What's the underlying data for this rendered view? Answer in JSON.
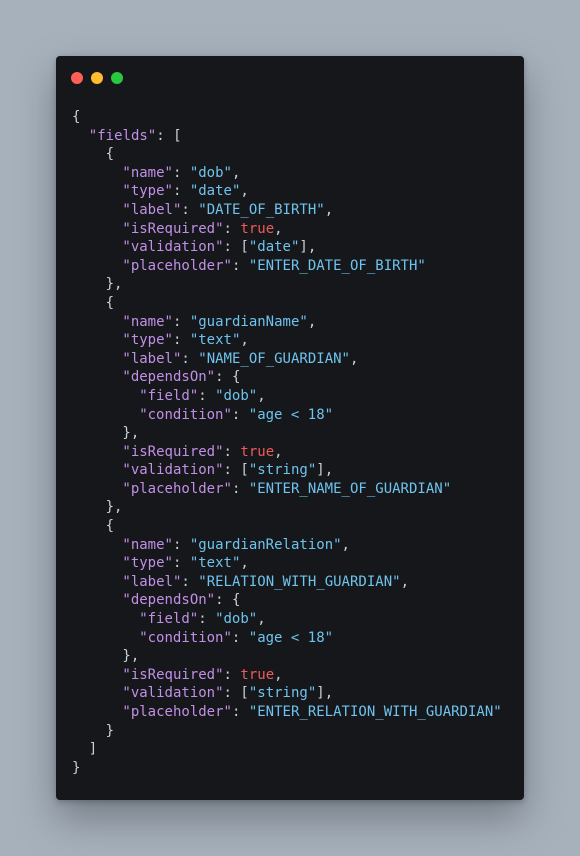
{
  "window": {
    "controls": [
      {
        "name": "close",
        "color": "#ff5f57"
      },
      {
        "name": "minimize",
        "color": "#febc2e"
      },
      {
        "name": "maximize",
        "color": "#28c840"
      }
    ]
  },
  "code": {
    "colors": {
      "key": "#c190e6",
      "string": "#6fc3ee",
      "boolean": "#ef5b5b",
      "punctuation": "#c9d1d9",
      "background": "#15171a",
      "page_background": "#a7b1bc"
    },
    "lines": [
      {
        "indent": 0,
        "tokens": [
          {
            "t": "p",
            "v": "{"
          }
        ]
      },
      {
        "indent": 1,
        "tokens": [
          {
            "t": "k",
            "v": "\"fields\""
          },
          {
            "t": "p",
            "v": ": ["
          }
        ]
      },
      {
        "indent": 2,
        "tokens": [
          {
            "t": "p",
            "v": "{"
          }
        ]
      },
      {
        "indent": 3,
        "tokens": [
          {
            "t": "k",
            "v": "\"name\""
          },
          {
            "t": "p",
            "v": ": "
          },
          {
            "t": "s",
            "v": "\"dob\""
          },
          {
            "t": "p",
            "v": ","
          }
        ]
      },
      {
        "indent": 3,
        "tokens": [
          {
            "t": "k",
            "v": "\"type\""
          },
          {
            "t": "p",
            "v": ": "
          },
          {
            "t": "s",
            "v": "\"date\""
          },
          {
            "t": "p",
            "v": ","
          }
        ]
      },
      {
        "indent": 3,
        "tokens": [
          {
            "t": "k",
            "v": "\"label\""
          },
          {
            "t": "p",
            "v": ": "
          },
          {
            "t": "s",
            "v": "\"DATE_OF_BIRTH\""
          },
          {
            "t": "p",
            "v": ","
          }
        ]
      },
      {
        "indent": 3,
        "tokens": [
          {
            "t": "k",
            "v": "\"isRequired\""
          },
          {
            "t": "p",
            "v": ": "
          },
          {
            "t": "b",
            "v": "true"
          },
          {
            "t": "p",
            "v": ","
          }
        ]
      },
      {
        "indent": 3,
        "tokens": [
          {
            "t": "k",
            "v": "\"validation\""
          },
          {
            "t": "p",
            "v": ": ["
          },
          {
            "t": "s",
            "v": "\"date\""
          },
          {
            "t": "p",
            "v": "],"
          }
        ]
      },
      {
        "indent": 3,
        "tokens": [
          {
            "t": "k",
            "v": "\"placeholder\""
          },
          {
            "t": "p",
            "v": ": "
          },
          {
            "t": "s",
            "v": "\"ENTER_DATE_OF_BIRTH\""
          }
        ]
      },
      {
        "indent": 2,
        "tokens": [
          {
            "t": "p",
            "v": "},"
          }
        ]
      },
      {
        "indent": 2,
        "tokens": [
          {
            "t": "p",
            "v": "{"
          }
        ]
      },
      {
        "indent": 3,
        "tokens": [
          {
            "t": "k",
            "v": "\"name\""
          },
          {
            "t": "p",
            "v": ": "
          },
          {
            "t": "s",
            "v": "\"guardianName\""
          },
          {
            "t": "p",
            "v": ","
          }
        ]
      },
      {
        "indent": 3,
        "tokens": [
          {
            "t": "k",
            "v": "\"type\""
          },
          {
            "t": "p",
            "v": ": "
          },
          {
            "t": "s",
            "v": "\"text\""
          },
          {
            "t": "p",
            "v": ","
          }
        ]
      },
      {
        "indent": 3,
        "tokens": [
          {
            "t": "k",
            "v": "\"label\""
          },
          {
            "t": "p",
            "v": ": "
          },
          {
            "t": "s",
            "v": "\"NAME_OF_GUARDIAN\""
          },
          {
            "t": "p",
            "v": ","
          }
        ]
      },
      {
        "indent": 3,
        "tokens": [
          {
            "t": "k",
            "v": "\"dependsOn\""
          },
          {
            "t": "p",
            "v": ": {"
          }
        ]
      },
      {
        "indent": 4,
        "tokens": [
          {
            "t": "k",
            "v": "\"field\""
          },
          {
            "t": "p",
            "v": ": "
          },
          {
            "t": "s",
            "v": "\"dob\""
          },
          {
            "t": "p",
            "v": ","
          }
        ]
      },
      {
        "indent": 4,
        "tokens": [
          {
            "t": "k",
            "v": "\"condition\""
          },
          {
            "t": "p",
            "v": ": "
          },
          {
            "t": "s",
            "v": "\"age < 18\""
          }
        ]
      },
      {
        "indent": 3,
        "tokens": [
          {
            "t": "p",
            "v": "},"
          }
        ]
      },
      {
        "indent": 3,
        "tokens": [
          {
            "t": "k",
            "v": "\"isRequired\""
          },
          {
            "t": "p",
            "v": ": "
          },
          {
            "t": "b",
            "v": "true"
          },
          {
            "t": "p",
            "v": ","
          }
        ]
      },
      {
        "indent": 3,
        "tokens": [
          {
            "t": "k",
            "v": "\"validation\""
          },
          {
            "t": "p",
            "v": ": ["
          },
          {
            "t": "s",
            "v": "\"string\""
          },
          {
            "t": "p",
            "v": "],"
          }
        ]
      },
      {
        "indent": 3,
        "tokens": [
          {
            "t": "k",
            "v": "\"placeholder\""
          },
          {
            "t": "p",
            "v": ": "
          },
          {
            "t": "s",
            "v": "\"ENTER_NAME_OF_GUARDIAN\""
          }
        ]
      },
      {
        "indent": 2,
        "tokens": [
          {
            "t": "p",
            "v": "},"
          }
        ]
      },
      {
        "indent": 2,
        "tokens": [
          {
            "t": "p",
            "v": "{"
          }
        ]
      },
      {
        "indent": 3,
        "tokens": [
          {
            "t": "k",
            "v": "\"name\""
          },
          {
            "t": "p",
            "v": ": "
          },
          {
            "t": "s",
            "v": "\"guardianRelation\""
          },
          {
            "t": "p",
            "v": ","
          }
        ]
      },
      {
        "indent": 3,
        "tokens": [
          {
            "t": "k",
            "v": "\"type\""
          },
          {
            "t": "p",
            "v": ": "
          },
          {
            "t": "s",
            "v": "\"text\""
          },
          {
            "t": "p",
            "v": ","
          }
        ]
      },
      {
        "indent": 3,
        "tokens": [
          {
            "t": "k",
            "v": "\"label\""
          },
          {
            "t": "p",
            "v": ": "
          },
          {
            "t": "s",
            "v": "\"RELATION_WITH_GUARDIAN\""
          },
          {
            "t": "p",
            "v": ","
          }
        ]
      },
      {
        "indent": 3,
        "tokens": [
          {
            "t": "k",
            "v": "\"dependsOn\""
          },
          {
            "t": "p",
            "v": ": {"
          }
        ]
      },
      {
        "indent": 4,
        "tokens": [
          {
            "t": "k",
            "v": "\"field\""
          },
          {
            "t": "p",
            "v": ": "
          },
          {
            "t": "s",
            "v": "\"dob\""
          },
          {
            "t": "p",
            "v": ","
          }
        ]
      },
      {
        "indent": 4,
        "tokens": [
          {
            "t": "k",
            "v": "\"condition\""
          },
          {
            "t": "p",
            "v": ": "
          },
          {
            "t": "s",
            "v": "\"age < 18\""
          }
        ]
      },
      {
        "indent": 3,
        "tokens": [
          {
            "t": "p",
            "v": "},"
          }
        ]
      },
      {
        "indent": 3,
        "tokens": [
          {
            "t": "k",
            "v": "\"isRequired\""
          },
          {
            "t": "p",
            "v": ": "
          },
          {
            "t": "b",
            "v": "true"
          },
          {
            "t": "p",
            "v": ","
          }
        ]
      },
      {
        "indent": 3,
        "tokens": [
          {
            "t": "k",
            "v": "\"validation\""
          },
          {
            "t": "p",
            "v": ": ["
          },
          {
            "t": "s",
            "v": "\"string\""
          },
          {
            "t": "p",
            "v": "],"
          }
        ]
      },
      {
        "indent": 3,
        "tokens": [
          {
            "t": "k",
            "v": "\"placeholder\""
          },
          {
            "t": "p",
            "v": ": "
          },
          {
            "t": "s",
            "v": "\"ENTER_RELATION_WITH_GUARDIAN\""
          }
        ]
      },
      {
        "indent": 2,
        "tokens": [
          {
            "t": "p",
            "v": "}"
          }
        ]
      },
      {
        "indent": 1,
        "tokens": [
          {
            "t": "p",
            "v": "]"
          }
        ]
      },
      {
        "indent": 0,
        "tokens": [
          {
            "t": "p",
            "v": "}"
          }
        ]
      }
    ]
  }
}
